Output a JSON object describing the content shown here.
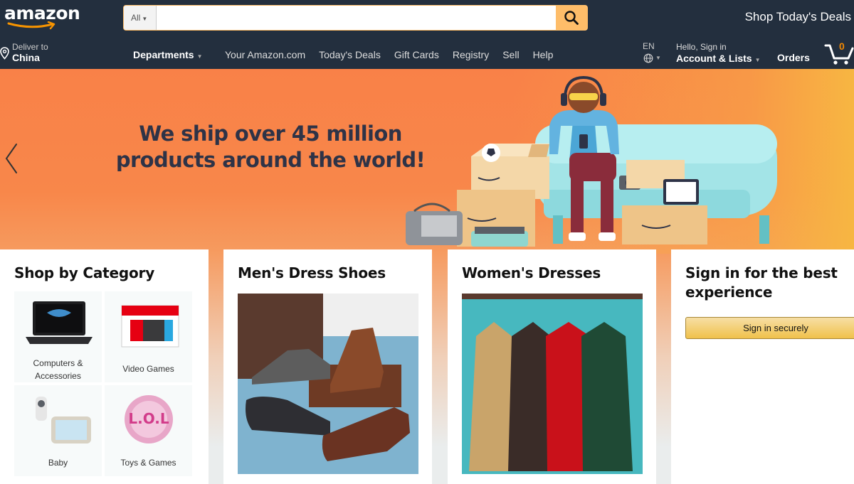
{
  "logo": {
    "text": "amazon"
  },
  "search": {
    "category": "All",
    "placeholder": "",
    "value": ""
  },
  "header": {
    "promo": "Shop Today's Deals"
  },
  "deliver": {
    "line1": "Deliver to",
    "line2": "China"
  },
  "nav": {
    "departments": "Departments",
    "links": [
      "Your Amazon.com",
      "Today's Deals",
      "Gift Cards",
      "Registry",
      "Sell",
      "Help"
    ]
  },
  "language": {
    "code": "EN"
  },
  "account": {
    "greeting": "Hello, Sign in",
    "label": "Account & Lists"
  },
  "orders": {
    "label": "Orders"
  },
  "cart": {
    "count": "0"
  },
  "hero": {
    "headline_line1": "We ship over 45 million",
    "headline_line2": "products around the world!"
  },
  "cards": {
    "category": {
      "title": "Shop by Category",
      "tiles": [
        {
          "label": "Computers & Accessories"
        },
        {
          "label": "Video Games"
        },
        {
          "label": "Baby"
        },
        {
          "label": "Toys & Games"
        }
      ]
    },
    "shoes": {
      "title": "Men's Dress Shoes"
    },
    "dresses": {
      "title": "Women's Dresses"
    },
    "signin": {
      "title": "Sign in for the best experience",
      "button": "Sign in securely"
    }
  },
  "colors": {
    "nav_bg": "#232f3e",
    "search_button": "#febd69",
    "cart_count": "#f08804",
    "hero_orange": "#f98148",
    "headline": "#2e3347"
  }
}
